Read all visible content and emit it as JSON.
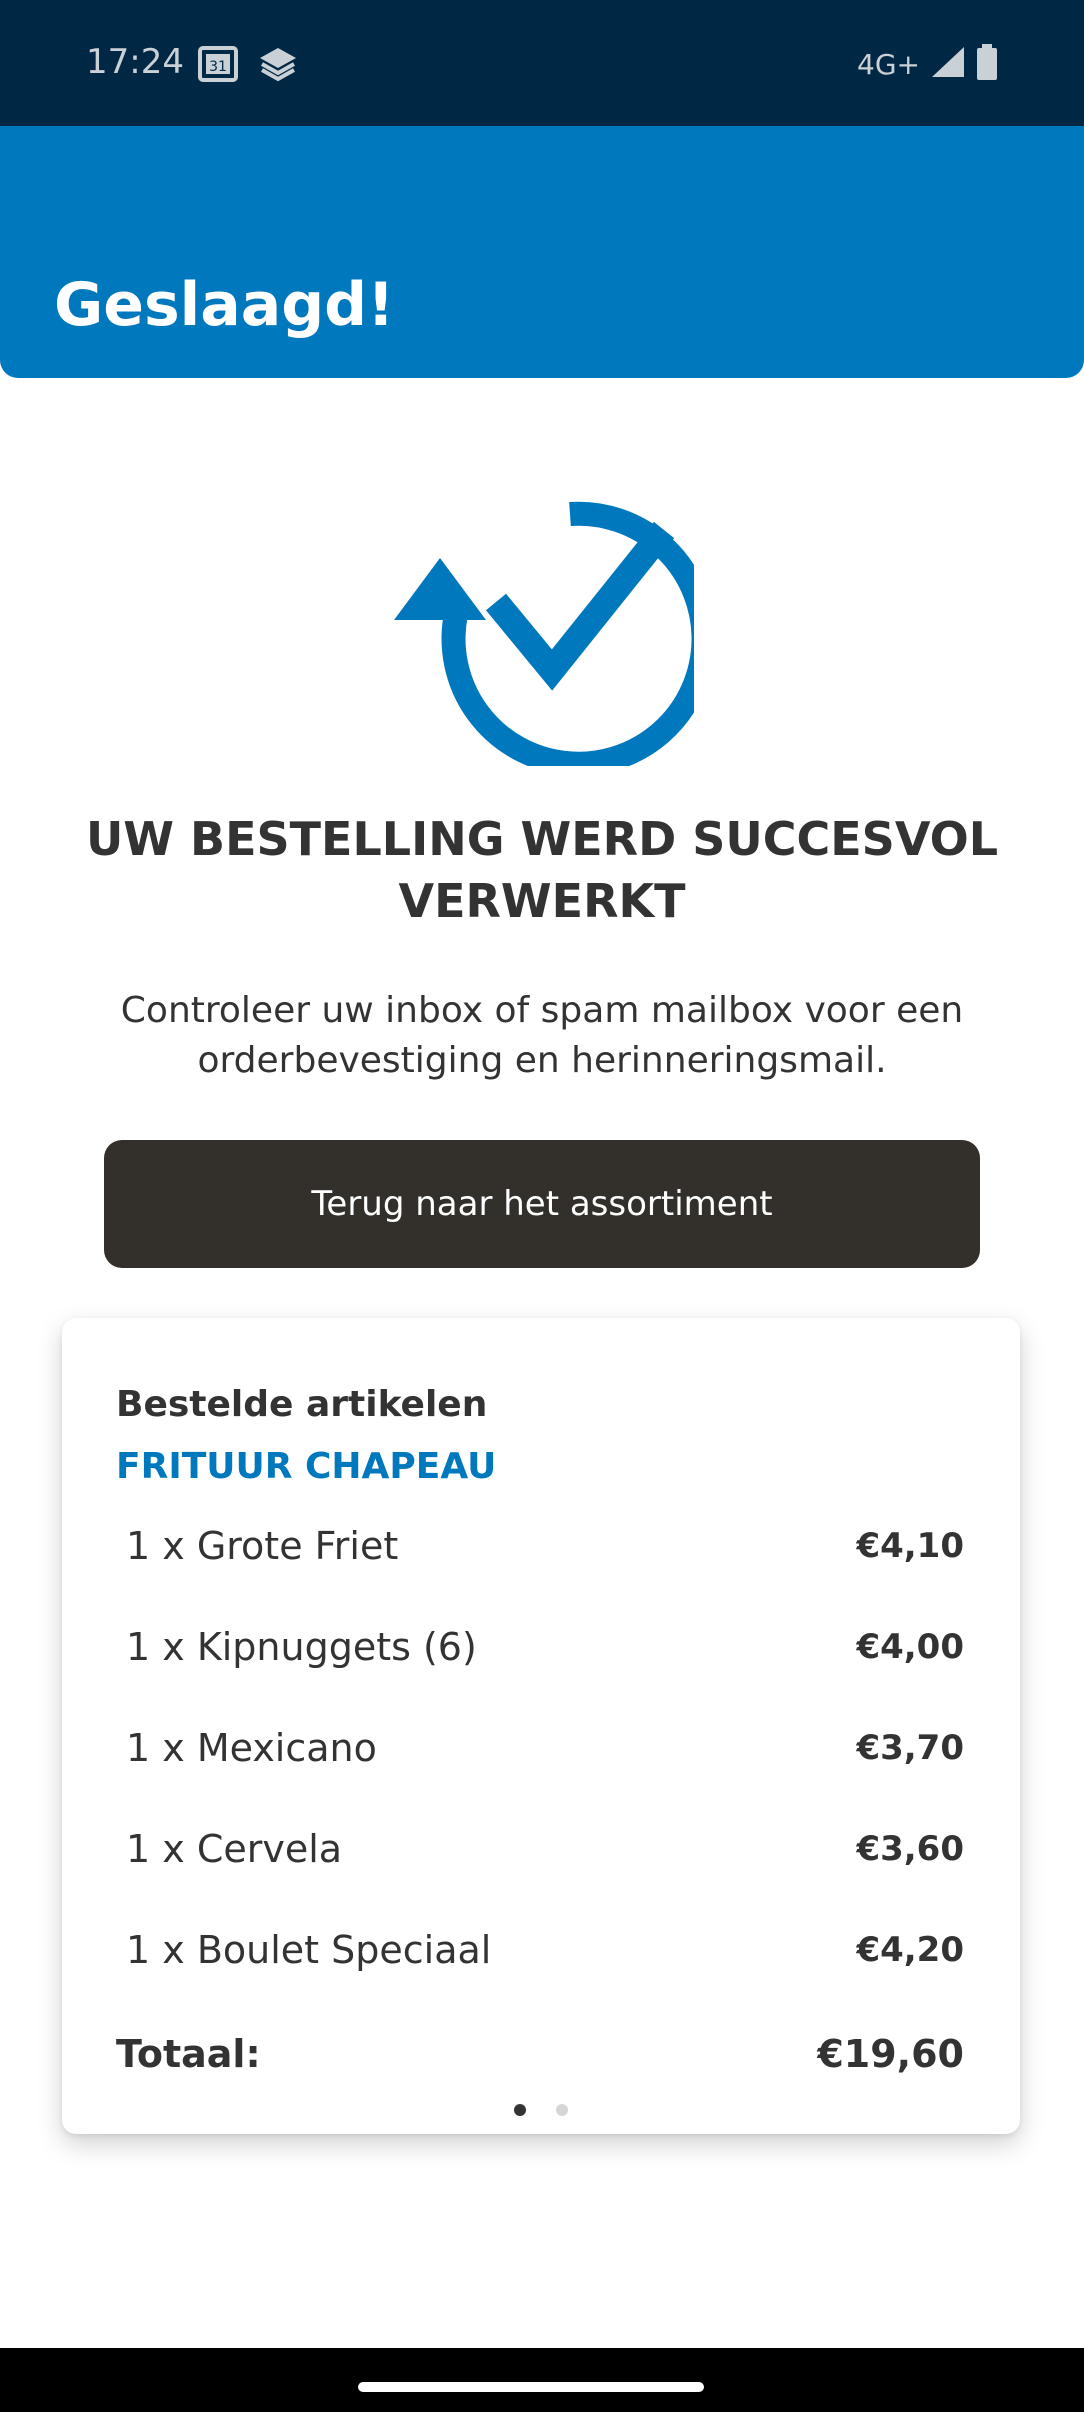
{
  "status_bar": {
    "time": "17:24",
    "network": "4G+",
    "icons": [
      "calendar-icon",
      "layers-icon",
      "signal-icon",
      "battery-icon"
    ]
  },
  "header": {
    "title": "Geslaagd!",
    "color": "#0078be"
  },
  "confirmation": {
    "icon": "checkmark-cycle-icon",
    "headline": "UW BESTELLING WERD SUCCESVOL VERWERKT",
    "message": "Controleer uw inbox of spam mailbox voor een orderbevestiging en herinneringsmail.",
    "back_button_label": "Terug naar het assortiment"
  },
  "order": {
    "title": "Bestelde artikelen",
    "shop": "FRITUUR CHAPEAU",
    "items": [
      {
        "name": "1 x Grote Friet",
        "price": "€4,10"
      },
      {
        "name": "1 x Kipnuggets (6)",
        "price": "€4,00"
      },
      {
        "name": "1 x Mexicano",
        "price": "€3,70"
      },
      {
        "name": "1 x Cervela",
        "price": "€3,60"
      },
      {
        "name": "1 x Boulet Speciaal",
        "price": "€4,20"
      }
    ],
    "total_label": "Totaal:",
    "total_value": "€19,60",
    "pager": {
      "pages": 2,
      "current": 1
    }
  }
}
